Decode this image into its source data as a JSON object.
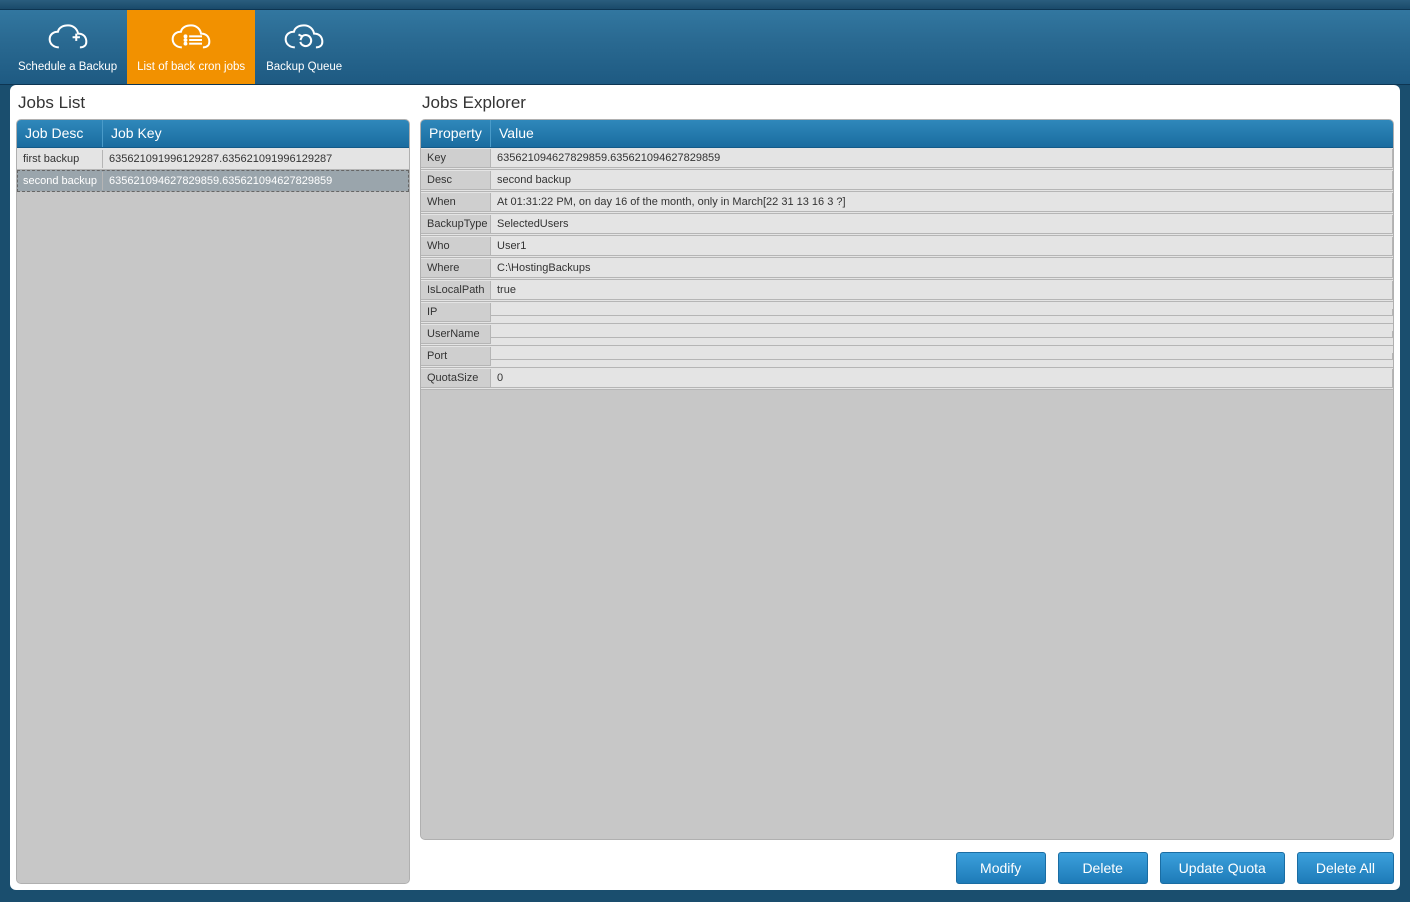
{
  "toolbar": {
    "schedule": {
      "label": "Schedule a Backup"
    },
    "list_cron": {
      "label": "List of back cron jobs"
    },
    "queue": {
      "label": "Backup Queue"
    }
  },
  "panels": {
    "jobs_list_title": "Jobs List",
    "jobs_explorer_title": "Jobs Explorer"
  },
  "jobs_list": {
    "headers": {
      "desc": "Job Desc",
      "key": "Job Key"
    },
    "rows": [
      {
        "desc": "first backup",
        "key": "635621091996129287.635621091996129287"
      },
      {
        "desc": "second backup",
        "key": "635621094627829859.635621094627829859"
      }
    ],
    "selected_index": 1
  },
  "jobs_explorer": {
    "headers": {
      "property": "Property",
      "value": "Value"
    },
    "props": [
      {
        "name": "Key",
        "value": "635621094627829859.635621094627829859"
      },
      {
        "name": "Desc",
        "value": "second backup"
      },
      {
        "name": "When",
        "value": "At 01:31:22 PM, on day 16 of the month, only in March[22 31 13 16 3 ?]"
      },
      {
        "name": "BackupType",
        "value": "SelectedUsers"
      },
      {
        "name": "Who",
        "value": "User1"
      },
      {
        "name": "Where",
        "value": "C:\\HostingBackups"
      },
      {
        "name": "IsLocalPath",
        "value": "true"
      },
      {
        "name": "IP",
        "value": ""
      },
      {
        "name": "UserName",
        "value": ""
      },
      {
        "name": "Port",
        "value": ""
      },
      {
        "name": "QuotaSize",
        "value": "0"
      }
    ]
  },
  "buttons": {
    "modify": "Modify",
    "delete": "Delete",
    "update_quota": "Update Quota",
    "delete_all": "Delete All"
  }
}
